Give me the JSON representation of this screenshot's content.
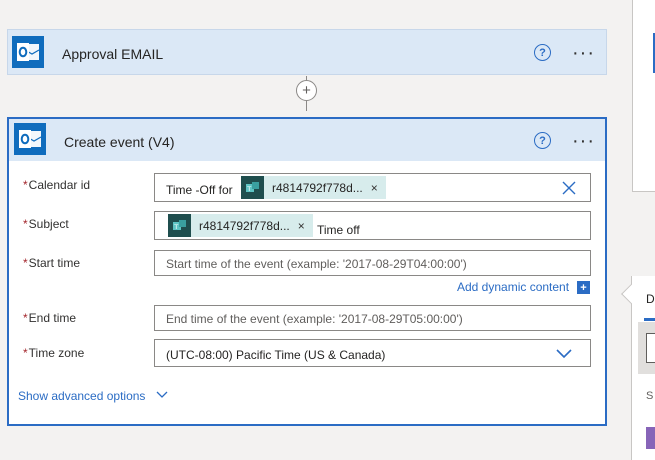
{
  "approval_card": {
    "title": "Approval EMAIL",
    "help_symbol": "?",
    "more_symbol": "···"
  },
  "connector": {
    "add_symbol": "+"
  },
  "create_event_card": {
    "title": "Create event (V4)",
    "help_symbol": "?",
    "more_symbol": "···",
    "fields": {
      "calendar_id": {
        "label": "Calendar id",
        "required_mark": "*",
        "prefix_text": "Time -Off for",
        "token": "r4814792f778d...",
        "token_close": "×"
      },
      "subject": {
        "label": "Subject",
        "required_mark": "*",
        "token": "r4814792f778d...",
        "token_close": "×",
        "suffix_text": "Time off"
      },
      "start_time": {
        "label": "Start time",
        "required_mark": "*",
        "placeholder": "Start time of the event (example: '2017-08-29T04:00:00')"
      },
      "end_time": {
        "label": "End time",
        "required_mark": "*",
        "placeholder": "End time of the event (example: '2017-08-29T05:00:00')"
      },
      "time_zone": {
        "label": "Time zone",
        "required_mark": "*",
        "value": "(UTC-08:00) Pacific Time (US & Canada)"
      }
    },
    "add_dynamic_content": "Add dynamic content",
    "add_dynamic_plus": "+",
    "show_advanced": "Show advanced options"
  },
  "flyout": {
    "tab_initial": "D",
    "row_initial": "S"
  },
  "colors": {
    "accent": "#2b6cc4",
    "header_bg": "#dbe8f6",
    "token_bg": "#d7ecec",
    "token_icon_bg": "#1f4e4e",
    "outlook_blue": "#0f6cbd",
    "required": "#a4262c"
  },
  "icons": {
    "outlook": "outlook-icon",
    "help": "help-circle-icon",
    "more": "more-horizontal-icon",
    "add_step": "plus-circle-icon",
    "arrow": "arrow-down-icon",
    "token_app": "teams-icon",
    "clear": "close-icon",
    "dropdown": "chevron-down-icon"
  }
}
